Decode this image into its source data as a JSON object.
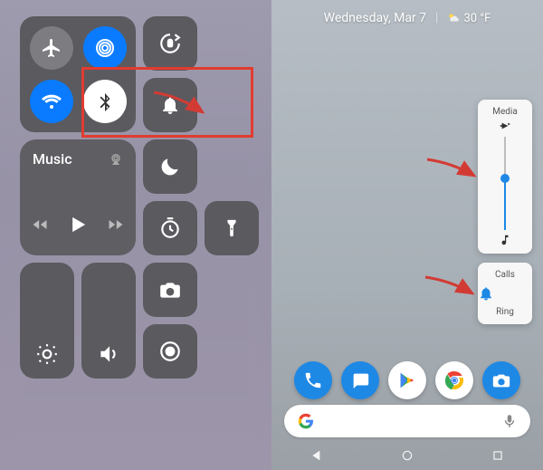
{
  "ios": {
    "music_label": "Music",
    "toggles": {
      "airplane": "airplane-mode",
      "airdrop": "airdrop",
      "wifi": "wifi",
      "bluetooth": "bluetooth",
      "rotation_lock": "rotation-lock",
      "bell": "ringer",
      "dnd": "do-not-disturb",
      "timer": "timer",
      "flashlight": "flashlight",
      "camera": "camera",
      "screen_record": "screen-record"
    },
    "sliders": {
      "brightness": "brightness",
      "volume": "volume"
    },
    "colors": {
      "tile": "#5a5a5f",
      "active_blue": "#0a7bff",
      "bt_white": "#ffffff",
      "highlight": "#e23b2f"
    }
  },
  "android": {
    "date": "Wednesday, Mar 7",
    "weather_icon": "partly-cloudy",
    "weather_temp": "30 °F",
    "media_panel_title": "Media",
    "media_volume_percent": 55,
    "calls_panel_title": "Calls",
    "calls_mode_label": "Ring",
    "dock": [
      {
        "name": "phone",
        "bg": "#1e88e5"
      },
      {
        "name": "messages",
        "bg": "#1e88e5"
      },
      {
        "name": "play-store",
        "bg": "#ffffff"
      },
      {
        "name": "chrome",
        "bg": "#ffffff"
      },
      {
        "name": "camera",
        "bg": "#1e88e5"
      }
    ],
    "nav": {
      "back": "back",
      "home": "home",
      "recents": "recents"
    },
    "search_provider": "Google",
    "colors": {
      "accent": "#1e88e5",
      "arrow": "#d23b34"
    }
  }
}
